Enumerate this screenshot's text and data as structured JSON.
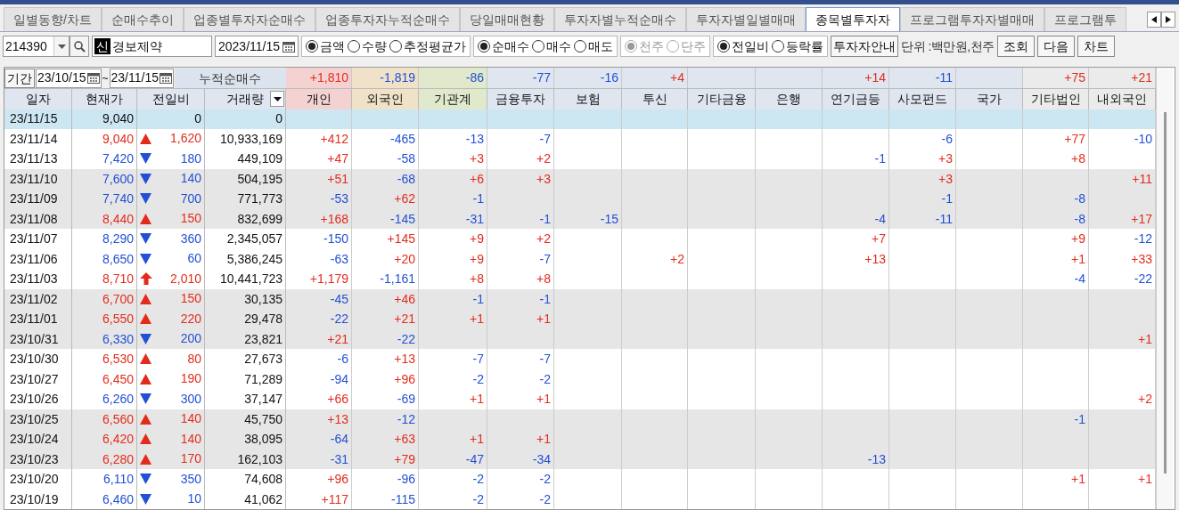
{
  "tabs": [
    {
      "label": "일별동향/차트",
      "selected": false
    },
    {
      "label": "순매수추이",
      "selected": false
    },
    {
      "label": "업종별투자자순매수",
      "selected": false
    },
    {
      "label": "업종투자자누적순매수",
      "selected": false
    },
    {
      "label": "당일매매현황",
      "selected": false
    },
    {
      "label": "투자자별누적순매수",
      "selected": false
    },
    {
      "label": "투자자별일별매매",
      "selected": false
    },
    {
      "label": "종목별투자자",
      "selected": true
    },
    {
      "label": "프로그램투자자별매매",
      "selected": false
    },
    {
      "label": "프로그램투",
      "selected": false
    }
  ],
  "toolbar": {
    "code": "214390",
    "stock_badge": "신",
    "stock_name": "경보제약",
    "date": "2023/11/15",
    "radio_groups": [
      {
        "disabled": false,
        "options": [
          {
            "label": "금액",
            "selected": true
          },
          {
            "label": "수량",
            "selected": false
          },
          {
            "label": "추정평균가",
            "selected": false
          }
        ]
      },
      {
        "disabled": false,
        "options": [
          {
            "label": "순매수",
            "selected": true
          },
          {
            "label": "매수",
            "selected": false
          },
          {
            "label": "매도",
            "selected": false
          }
        ]
      },
      {
        "disabled": true,
        "options": [
          {
            "label": "천주",
            "selected": true
          },
          {
            "label": "단주",
            "selected": false
          }
        ]
      },
      {
        "disabled": false,
        "options": [
          {
            "label": "전일비",
            "selected": true
          },
          {
            "label": "등락률",
            "selected": false
          }
        ]
      }
    ],
    "guide_button": "투자자안내",
    "unit": "단위 :백만원,천주",
    "buttons": [
      "조회",
      "다음",
      "차트"
    ]
  },
  "period": {
    "button": "기간",
    "from": "23/10/15",
    "separator": "~",
    "to": "23/11/15",
    "label": "누적순매수"
  },
  "summary": {
    "individual": "+1,810",
    "foreign": "-1,819",
    "institutions": "-86",
    "financial_investment": "-77",
    "insurance": "-16",
    "investment_trust": "+4",
    "pension": "+14",
    "private_equity": "-11",
    "other_corporation": "+75",
    "domestic_foreign": "+21"
  },
  "columns": [
    {
      "label": "일자",
      "has_menu": false
    },
    {
      "label": "현재가",
      "has_menu": false
    },
    {
      "label": "전일비",
      "has_menu": false
    },
    {
      "label": "거래량",
      "has_menu": true
    },
    {
      "label": "개인",
      "has_menu": false,
      "color": "#f4d2d2"
    },
    {
      "label": "외국인",
      "has_menu": false,
      "color": "#f0e2c8"
    },
    {
      "label": "기관계",
      "has_menu": false,
      "color": "#e0e9cc"
    },
    {
      "label": "금융투자",
      "has_menu": false,
      "color": "#dfe6f0"
    },
    {
      "label": "보험",
      "has_menu": false,
      "color": "#dfe6f0"
    },
    {
      "label": "투신",
      "has_menu": false,
      "color": "#dfe6f0"
    },
    {
      "label": "기타금융",
      "has_menu": false,
      "color": "#dfe6f0"
    },
    {
      "label": "은행",
      "has_menu": false,
      "color": "#dfe6f0"
    },
    {
      "label": "연기금등",
      "has_menu": false,
      "color": "#dfe6f0"
    },
    {
      "label": "사모펀드",
      "has_menu": false,
      "color": "#dfe6f0"
    },
    {
      "label": "국가",
      "has_menu": false,
      "color": "#dfe6f0"
    },
    {
      "label": "기타법인",
      "has_menu": false,
      "color": "#ebebeb"
    },
    {
      "label": "내외국인",
      "has_menu": false,
      "color": "#ebebeb"
    }
  ],
  "rows": [
    {
      "date": "23/11/15",
      "price": "9,040",
      "kind": "flat",
      "diff": "0",
      "volume": "0",
      "selected": true,
      "shaded": false,
      "investors": {}
    },
    {
      "date": "23/11/14",
      "price": "9,040",
      "kind": "up",
      "diff": "1,620",
      "volume": "10,933,169",
      "selected": false,
      "shaded": false,
      "investors": {
        "individual": "+412",
        "foreign": "-465",
        "institutions": "-13",
        "financial_investment": "-7",
        "private_equity": "-6",
        "other_corporation": "+77",
        "domestic_foreign": "-10"
      }
    },
    {
      "date": "23/11/13",
      "price": "7,420",
      "kind": "down",
      "diff": "180",
      "volume": "449,109",
      "selected": false,
      "shaded": false,
      "investors": {
        "individual": "+47",
        "foreign": "-58",
        "institutions": "+3",
        "financial_investment": "+2",
        "pension": "-1",
        "private_equity": "+3",
        "other_corporation": "+8"
      }
    },
    {
      "date": "23/11/10",
      "price": "7,600",
      "kind": "down",
      "diff": "140",
      "volume": "504,195",
      "selected": false,
      "shaded": true,
      "investors": {
        "individual": "+51",
        "foreign": "-68",
        "institutions": "+6",
        "financial_investment": "+3",
        "private_equity": "+3",
        "domestic_foreign": "+11"
      }
    },
    {
      "date": "23/11/09",
      "price": "7,740",
      "kind": "down",
      "diff": "700",
      "volume": "771,773",
      "selected": false,
      "shaded": true,
      "investors": {
        "individual": "-53",
        "foreign": "+62",
        "institutions": "-1",
        "private_equity": "-1",
        "other_corporation": "-8"
      }
    },
    {
      "date": "23/11/08",
      "price": "8,440",
      "kind": "up",
      "diff": "150",
      "volume": "832,699",
      "selected": false,
      "shaded": true,
      "investors": {
        "individual": "+168",
        "foreign": "-145",
        "institutions": "-31",
        "financial_investment": "-1",
        "insurance": "-15",
        "pension": "-4",
        "private_equity": "-11",
        "other_corporation": "-8",
        "domestic_foreign": "+17"
      }
    },
    {
      "date": "23/11/07",
      "price": "8,290",
      "kind": "down",
      "diff": "360",
      "volume": "2,345,057",
      "selected": false,
      "shaded": false,
      "investors": {
        "individual": "-150",
        "foreign": "+145",
        "institutions": "+9",
        "financial_investment": "+2",
        "pension": "+7",
        "other_corporation": "+9",
        "domestic_foreign": "-12"
      }
    },
    {
      "date": "23/11/06",
      "price": "8,650",
      "kind": "down",
      "diff": "60",
      "volume": "5,386,245",
      "selected": false,
      "shaded": false,
      "investors": {
        "individual": "-63",
        "foreign": "+20",
        "institutions": "+9",
        "financial_investment": "-7",
        "investment_trust": "+2",
        "pension": "+13",
        "other_corporation": "+1",
        "domestic_foreign": "+33"
      }
    },
    {
      "date": "23/11/03",
      "price": "8,710",
      "kind": "upper_limit",
      "diff": "2,010",
      "volume": "10,441,723",
      "selected": false,
      "shaded": false,
      "investors": {
        "individual": "+1,179",
        "foreign": "-1,161",
        "institutions": "+8",
        "financial_investment": "+8",
        "other_corporation": "-4",
        "domestic_foreign": "-22"
      }
    },
    {
      "date": "23/11/02",
      "price": "6,700",
      "kind": "up",
      "diff": "150",
      "volume": "30,135",
      "selected": false,
      "shaded": true,
      "investors": {
        "individual": "-45",
        "foreign": "+46",
        "institutions": "-1",
        "financial_investment": "-1"
      }
    },
    {
      "date": "23/11/01",
      "price": "6,550",
      "kind": "up",
      "diff": "220",
      "volume": "29,478",
      "selected": false,
      "shaded": true,
      "investors": {
        "individual": "-22",
        "foreign": "+21",
        "institutions": "+1",
        "financial_investment": "+1"
      }
    },
    {
      "date": "23/10/31",
      "price": "6,330",
      "kind": "down",
      "diff": "200",
      "volume": "23,821",
      "selected": false,
      "shaded": true,
      "investors": {
        "individual": "+21",
        "foreign": "-22",
        "domestic_foreign": "+1"
      }
    },
    {
      "date": "23/10/30",
      "price": "6,530",
      "kind": "up",
      "diff": "80",
      "volume": "27,673",
      "selected": false,
      "shaded": false,
      "investors": {
        "individual": "-6",
        "foreign": "+13",
        "institutions": "-7",
        "financial_investment": "-7"
      }
    },
    {
      "date": "23/10/27",
      "price": "6,450",
      "kind": "up",
      "diff": "190",
      "volume": "71,289",
      "selected": false,
      "shaded": false,
      "investors": {
        "individual": "-94",
        "foreign": "+96",
        "institutions": "-2",
        "financial_investment": "-2"
      }
    },
    {
      "date": "23/10/26",
      "price": "6,260",
      "kind": "down",
      "diff": "300",
      "volume": "37,147",
      "selected": false,
      "shaded": false,
      "investors": {
        "individual": "+66",
        "foreign": "-69",
        "institutions": "+1",
        "financial_investment": "+1",
        "domestic_foreign": "+2"
      }
    },
    {
      "date": "23/10/25",
      "price": "6,560",
      "kind": "up",
      "diff": "140",
      "volume": "45,750",
      "selected": false,
      "shaded": true,
      "investors": {
        "individual": "+13",
        "foreign": "-12",
        "other_corporation": "-1"
      }
    },
    {
      "date": "23/10/24",
      "price": "6,420",
      "kind": "up",
      "diff": "140",
      "volume": "38,095",
      "selected": false,
      "shaded": true,
      "investors": {
        "individual": "-64",
        "foreign": "+63",
        "institutions": "+1",
        "financial_investment": "+1"
      }
    },
    {
      "date": "23/10/23",
      "price": "6,280",
      "kind": "up",
      "diff": "170",
      "volume": "162,103",
      "selected": false,
      "shaded": true,
      "investors": {
        "individual": "-31",
        "foreign": "+79",
        "institutions": "-47",
        "financial_investment": "-34",
        "pension": "-13"
      }
    },
    {
      "date": "23/10/20",
      "price": "6,110",
      "kind": "down",
      "diff": "350",
      "volume": "74,608",
      "selected": false,
      "shaded": false,
      "investors": {
        "individual": "+96",
        "foreign": "-96",
        "institutions": "-2",
        "financial_investment": "-2",
        "other_corporation": "+1",
        "domestic_foreign": "+1"
      }
    },
    {
      "date": "23/10/19",
      "price": "6,460",
      "kind": "down",
      "diff": "10",
      "volume": "41,062",
      "selected": false,
      "shaded": false,
      "investors": {
        "individual": "+117",
        "foreign": "-115",
        "institutions": "-2",
        "financial_investment": "-2"
      }
    }
  ]
}
